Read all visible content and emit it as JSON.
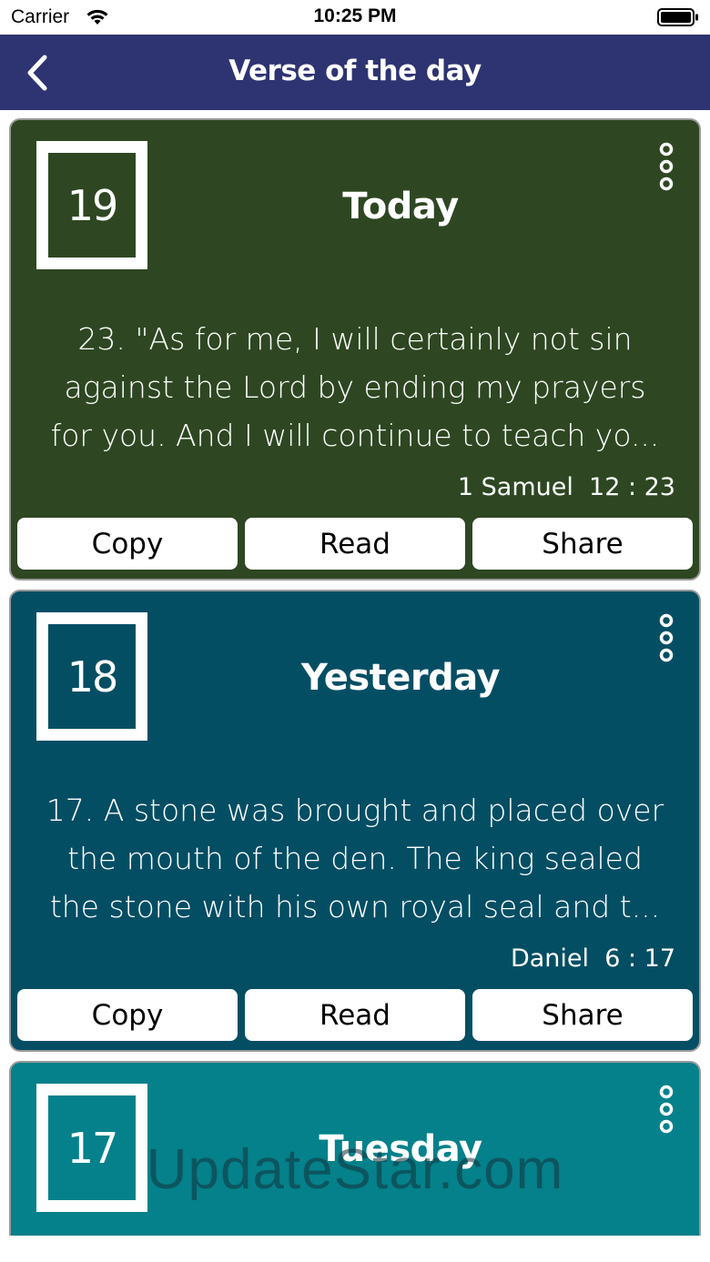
{
  "status_bar": {
    "carrier": "Carrier",
    "time": "10:25 PM"
  },
  "nav": {
    "title": "Verse of the day",
    "back_icon": "chevron-left-icon"
  },
  "cards": [
    {
      "date": "19",
      "day": "Today",
      "color": "#2e4722",
      "verse_lines": [
        "23. \"As for me, I will certainly not sin",
        "against the Lord by ending my prayers",
        "for you. And I will continue to teach yo..."
      ],
      "reference": "1 Samuel  12 : 23",
      "copy_label": "Copy",
      "read_label": "Read",
      "share_label": "Share"
    },
    {
      "date": "18",
      "day": "Yesterday",
      "color": "#044e64",
      "verse_lines": [
        "17. A stone was brought and placed over",
        "the mouth of the den. The king sealed",
        "the stone with his own royal seal and t..."
      ],
      "reference": "Daniel  6 : 17",
      "copy_label": "Copy",
      "read_label": "Read",
      "share_label": "Share"
    },
    {
      "date": "17",
      "day": "Tuesday",
      "color": "#04818a"
    }
  ],
  "watermark": "UpdateStar.com"
}
